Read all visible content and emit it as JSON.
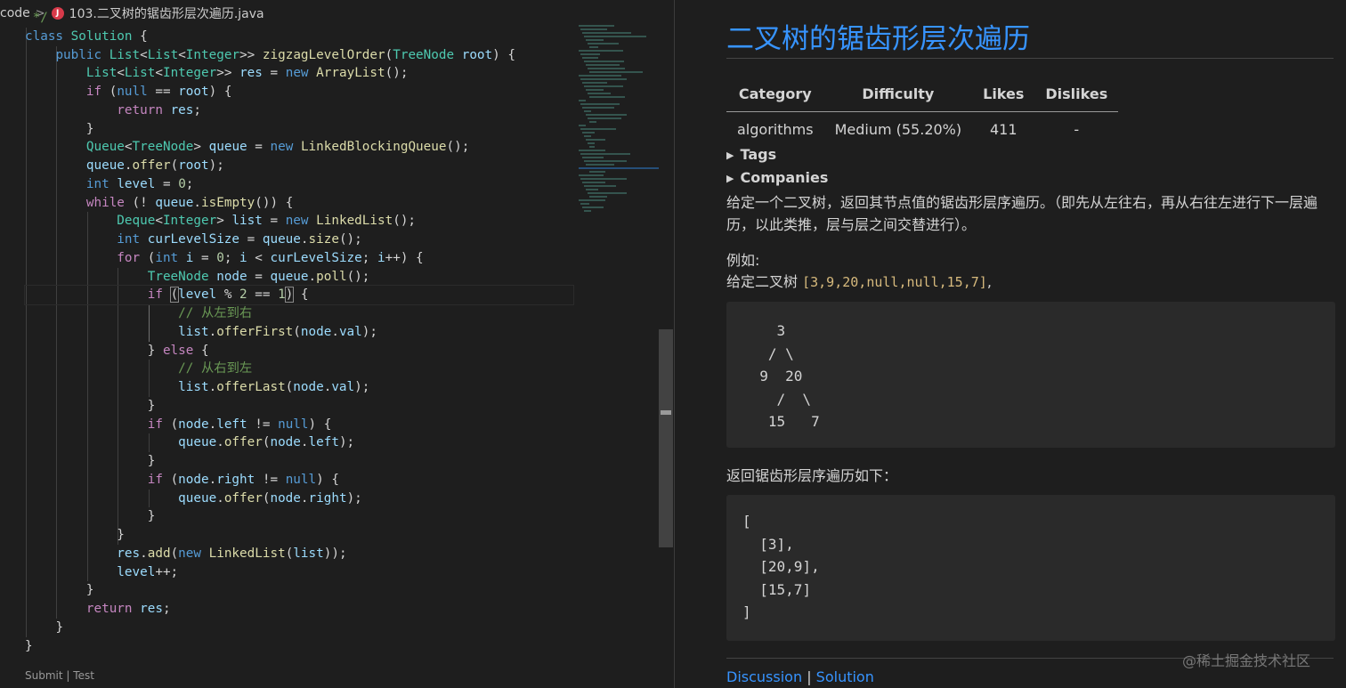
{
  "breadcrumb": {
    "root": "code",
    "separator": ">",
    "file_badge": "J",
    "file_name": "103.二叉树的锯齿形层次遍历.java"
  },
  "editor": {
    "code_lines": [
      [
        [
          "cm",
          "*/"
        ]
      ],
      [
        [
          "kw",
          "class "
        ],
        [
          "ty",
          "Solution"
        ],
        [
          "pl",
          " {"
        ]
      ],
      [
        [
          "kw",
          "public "
        ],
        [
          "ty",
          "List"
        ],
        [
          "pl",
          "<"
        ],
        [
          "ty",
          "List"
        ],
        [
          "pl",
          "<"
        ],
        [
          "ty",
          "Integer"
        ],
        [
          "pl",
          ">> "
        ],
        [
          "fn",
          "zigzagLevelOrder"
        ],
        [
          "pl",
          "("
        ],
        [
          "ty",
          "TreeNode"
        ],
        [
          "pl",
          " "
        ],
        [
          "var",
          "root"
        ],
        [
          "pl",
          ") {"
        ]
      ],
      [
        [
          "ty",
          "List"
        ],
        [
          "pl",
          "<"
        ],
        [
          "ty",
          "List"
        ],
        [
          "pl",
          "<"
        ],
        [
          "ty",
          "Integer"
        ],
        [
          "pl",
          ">> "
        ],
        [
          "var",
          "res"
        ],
        [
          "pl",
          " = "
        ],
        [
          "kw",
          "new "
        ],
        [
          "fn",
          "ArrayList"
        ],
        [
          "pl",
          "();"
        ]
      ],
      [
        [
          "ctl",
          "if "
        ],
        [
          "pl",
          "("
        ],
        [
          "kw",
          "null"
        ],
        [
          "pl",
          " == "
        ],
        [
          "var",
          "root"
        ],
        [
          "pl",
          ") {"
        ]
      ],
      [
        [
          "ctl",
          "return "
        ],
        [
          "var",
          "res"
        ],
        [
          "pl",
          ";"
        ]
      ],
      [
        [
          "pl",
          "}"
        ]
      ],
      [
        [
          "ty",
          "Queue"
        ],
        [
          "pl",
          "<"
        ],
        [
          "ty",
          "TreeNode"
        ],
        [
          "pl",
          "> "
        ],
        [
          "var",
          "queue"
        ],
        [
          "pl",
          " = "
        ],
        [
          "kw",
          "new "
        ],
        [
          "fn",
          "LinkedBlockingQueue"
        ],
        [
          "pl",
          "();"
        ]
      ],
      [
        [
          "var",
          "queue"
        ],
        [
          "pl",
          "."
        ],
        [
          "fn",
          "offer"
        ],
        [
          "pl",
          "("
        ],
        [
          "var",
          "root"
        ],
        [
          "pl",
          ");"
        ]
      ],
      [
        [
          "kw",
          "int "
        ],
        [
          "var",
          "level"
        ],
        [
          "pl",
          " = "
        ],
        [
          "num",
          "0"
        ],
        [
          "pl",
          ";"
        ]
      ],
      [
        [
          "ctl",
          "while "
        ],
        [
          "pl",
          "(! "
        ],
        [
          "var",
          "queue"
        ],
        [
          "pl",
          "."
        ],
        [
          "fn",
          "isEmpty"
        ],
        [
          "pl",
          "()) {"
        ]
      ],
      [
        [
          "ty",
          "Deque"
        ],
        [
          "pl",
          "<"
        ],
        [
          "ty",
          "Integer"
        ],
        [
          "pl",
          "> "
        ],
        [
          "var",
          "list"
        ],
        [
          "pl",
          " = "
        ],
        [
          "kw",
          "new "
        ],
        [
          "fn",
          "LinkedList"
        ],
        [
          "pl",
          "();"
        ]
      ],
      [
        [
          "kw",
          "int "
        ],
        [
          "var",
          "curLevelSize"
        ],
        [
          "pl",
          " = "
        ],
        [
          "var",
          "queue"
        ],
        [
          "pl",
          "."
        ],
        [
          "fn",
          "size"
        ],
        [
          "pl",
          "();"
        ]
      ],
      [
        [
          "ctl",
          "for "
        ],
        [
          "pl",
          "("
        ],
        [
          "kw",
          "int "
        ],
        [
          "var",
          "i"
        ],
        [
          "pl",
          " = "
        ],
        [
          "num",
          "0"
        ],
        [
          "pl",
          "; "
        ],
        [
          "var",
          "i"
        ],
        [
          "pl",
          " < "
        ],
        [
          "var",
          "curLevelSize"
        ],
        [
          "pl",
          "; "
        ],
        [
          "var",
          "i"
        ],
        [
          "pl",
          "++) {"
        ]
      ],
      [
        [
          "ty",
          "TreeNode"
        ],
        [
          "pl",
          " "
        ],
        [
          "var",
          "node"
        ],
        [
          "pl",
          " = "
        ],
        [
          "var",
          "queue"
        ],
        [
          "pl",
          "."
        ],
        [
          "fn",
          "poll"
        ],
        [
          "pl",
          "();"
        ]
      ],
      [
        [
          "ctl",
          "if "
        ],
        [
          "paren",
          "("
        ],
        [
          "var",
          "level"
        ],
        [
          "pl",
          " % "
        ],
        [
          "num",
          "2"
        ],
        [
          "pl",
          " == "
        ],
        [
          "num",
          "1"
        ],
        [
          "paren",
          ")"
        ],
        [
          "pl",
          " {"
        ]
      ],
      [
        [
          "cm",
          "// 从左到右"
        ]
      ],
      [
        [
          "var",
          "list"
        ],
        [
          "pl",
          "."
        ],
        [
          "fn",
          "offerFirst"
        ],
        [
          "pl",
          "("
        ],
        [
          "var",
          "node"
        ],
        [
          "pl",
          "."
        ],
        [
          "var",
          "val"
        ],
        [
          "pl",
          ");"
        ]
      ],
      [
        [
          "pl",
          "} "
        ],
        [
          "ctl",
          "else"
        ],
        [
          "pl",
          " {"
        ]
      ],
      [
        [
          "cm",
          "// 从右到左"
        ]
      ],
      [
        [
          "var",
          "list"
        ],
        [
          "pl",
          "."
        ],
        [
          "fn",
          "offerLast"
        ],
        [
          "pl",
          "("
        ],
        [
          "var",
          "node"
        ],
        [
          "pl",
          "."
        ],
        [
          "var",
          "val"
        ],
        [
          "pl",
          ");"
        ]
      ],
      [
        [
          "pl",
          "}"
        ]
      ],
      [
        [
          "ctl",
          "if "
        ],
        [
          "pl",
          "("
        ],
        [
          "var",
          "node"
        ],
        [
          "pl",
          "."
        ],
        [
          "var",
          "left"
        ],
        [
          "pl",
          " != "
        ],
        [
          "kw",
          "null"
        ],
        [
          "pl",
          ") {"
        ]
      ],
      [
        [
          "var",
          "queue"
        ],
        [
          "pl",
          "."
        ],
        [
          "fn",
          "offer"
        ],
        [
          "pl",
          "("
        ],
        [
          "var",
          "node"
        ],
        [
          "pl",
          "."
        ],
        [
          "var",
          "left"
        ],
        [
          "pl",
          ");"
        ]
      ],
      [
        [
          "pl",
          "}"
        ]
      ],
      [
        [
          "ctl",
          "if "
        ],
        [
          "pl",
          "("
        ],
        [
          "var",
          "node"
        ],
        [
          "pl",
          "."
        ],
        [
          "var",
          "right"
        ],
        [
          "pl",
          " != "
        ],
        [
          "kw",
          "null"
        ],
        [
          "pl",
          ") {"
        ]
      ],
      [
        [
          "var",
          "queue"
        ],
        [
          "pl",
          "."
        ],
        [
          "fn",
          "offer"
        ],
        [
          "pl",
          "("
        ],
        [
          "var",
          "node"
        ],
        [
          "pl",
          "."
        ],
        [
          "var",
          "right"
        ],
        [
          "pl",
          ");"
        ]
      ],
      [
        [
          "pl",
          "}"
        ]
      ],
      [
        [
          "pl",
          "}"
        ]
      ],
      [
        [
          "var",
          "res"
        ],
        [
          "pl",
          "."
        ],
        [
          "fn",
          "add"
        ],
        [
          "pl",
          "("
        ],
        [
          "kw",
          "new "
        ],
        [
          "fn",
          "LinkedList"
        ],
        [
          "pl",
          "("
        ],
        [
          "var",
          "list"
        ],
        [
          "pl",
          "));"
        ]
      ],
      [
        [
          "var",
          "level"
        ],
        [
          "pl",
          "++;"
        ]
      ],
      [
        [
          "pl",
          "}"
        ]
      ],
      [
        [
          "ctl",
          "return "
        ],
        [
          "var",
          "res"
        ],
        [
          "pl",
          ";"
        ]
      ],
      [
        [
          "pl",
          "}"
        ]
      ],
      [
        [
          "pl",
          "}"
        ]
      ]
    ],
    "code_lens": {
      "submit": "Submit",
      "separator": "|",
      "test": "Test"
    }
  },
  "preview": {
    "title": "二叉树的锯齿形层次遍历",
    "table": {
      "headers": [
        "Category",
        "Difficulty",
        "Likes",
        "Dislikes"
      ],
      "row": [
        "algorithms",
        "Medium (55.20%)",
        "411",
        "-"
      ]
    },
    "tags_label": "Tags",
    "companies_label": "Companies",
    "description": "给定一个二叉树，返回其节点值的锯齿形层序遍历。（即先从左往右，再从右往左进行下一层遍历，以此类推，层与层之间交替进行）。",
    "example_label": "例如:",
    "given_prefix": "给定二叉树 ",
    "given_code": "[3,9,20,null,null,15,7]",
    "given_suffix": ",",
    "tree_lines": [
      "    3",
      "   / \\",
      "  9  20",
      "    /  \\",
      "   15   7"
    ],
    "return_label": "返回锯齿形层序遍历如下：",
    "result_lines": [
      "[",
      "  [3],",
      "  [20,9],",
      "  [15,7]",
      "]"
    ],
    "discussion_link": "Discussion",
    "link_separator": "|",
    "solution_link": "Solution",
    "watermark": "@稀土掘金技术社区"
  }
}
